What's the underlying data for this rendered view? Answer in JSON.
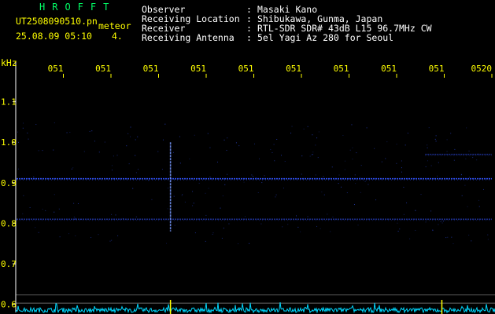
{
  "header": {
    "brand": "HROFFT",
    "filename": "UT2508090510.pn",
    "tag": "meteor",
    "datetime": "25.08.09 05:10",
    "station_id": "4.",
    "rows": [
      {
        "label": "Observer",
        "value": "Masaki Kano"
      },
      {
        "label": "Receiving Location",
        "value": "Shibukawa, Gunma, Japan"
      },
      {
        "label": "Receiver",
        "value": "RTL-SDR SDR# 43dB L15 96.7MHz CW"
      },
      {
        "label": "Receiving Antenna",
        "value": "5el Yagi Az 280 for Seoul"
      }
    ]
  },
  "chart_data": {
    "type": "heatmap",
    "ylabel": "kHz",
    "y_ticks": [
      "1.1",
      "1.0",
      "0.9",
      "0.8",
      "0.7",
      "0.6"
    ],
    "y_tick_values": [
      1.1,
      1.0,
      0.9,
      0.8,
      0.7,
      0.6
    ],
    "ylim": [
      0.58,
      1.2
    ],
    "x_ticks": [
      "051",
      "051",
      "051",
      "051",
      "051",
      "051",
      "051",
      "051",
      "051",
      "0520"
    ],
    "x_tick_minutes": [
      11,
      12,
      13,
      14,
      15,
      16,
      17,
      18,
      19,
      20
    ],
    "xlim": [
      10,
      20
    ],
    "signals": [
      {
        "freq_khz": 0.91,
        "x_range": [
          10,
          20
        ],
        "intensity": 0.95
      },
      {
        "freq_khz": 0.81,
        "x_range": [
          10,
          20
        ],
        "intensity": 0.55
      },
      {
        "freq_khz": 0.97,
        "x_range": [
          18.6,
          20
        ],
        "intensity": 0.5
      }
    ],
    "bursts": [
      {
        "minute": 13.25,
        "f_low": 0.78,
        "f_high": 1.0,
        "intensity": 0.85
      }
    ],
    "reference_lines_khz": [
      0.623,
      0.603
    ],
    "colors": {
      "background": "#000000",
      "signal": "#3355ff",
      "signal_bright": "#7799ff",
      "text": "#ffff00",
      "grid": "#ffffff",
      "spectrum": "#00d8ff",
      "marker": "#ffff00"
    }
  }
}
